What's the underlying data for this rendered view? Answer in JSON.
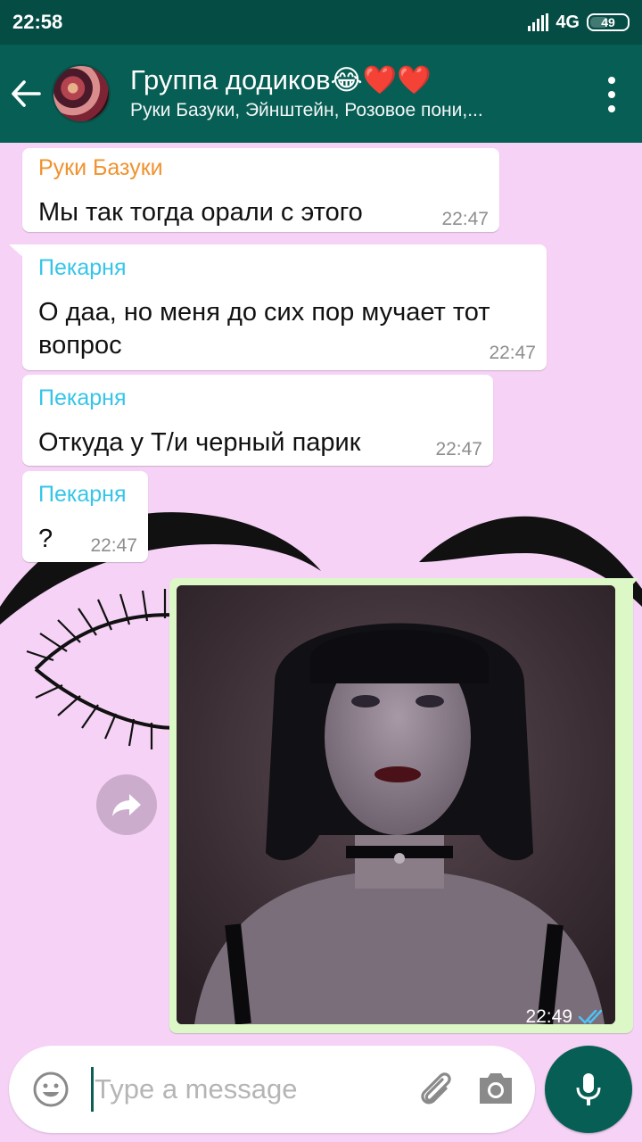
{
  "status_bar": {
    "time": "22:58",
    "network": "4G",
    "battery": "49"
  },
  "header": {
    "title": "Группа додиков😂❤️❤️",
    "subtitle": "Руки Базуки, Эйнштейн, Розовое пони,...",
    "back_icon": "arrow-left-icon",
    "menu_icon": "more-vert-icon"
  },
  "messages": [
    {
      "sender": "Руки Базуки",
      "sender_color": "#f0922e",
      "text": "Мы так тогда орали с этого",
      "time": "22:47"
    },
    {
      "sender": "Пекарня",
      "sender_color": "#35c5e8",
      "text": "О даа, но меня до сих пор мучает тот вопрос",
      "time": "22:47"
    },
    {
      "sender": "Пекарня",
      "sender_color": "#35c5e8",
      "text": "Откуда у Т/и черный парик",
      "time": "22:47"
    },
    {
      "sender": "Пекарня",
      "sender_color": "#35c5e8",
      "text": "?",
      "time": "22:47"
    }
  ],
  "photo_message": {
    "time": "22:49",
    "status": "read",
    "tick_color": "#4fc3f7"
  },
  "composer": {
    "placeholder": "Type a message",
    "value": ""
  },
  "colors": {
    "header": "#075e54",
    "status_bar": "#054d44",
    "chat_background": "#f6d3f6",
    "outgoing_bubble": "#dcf8c6"
  }
}
